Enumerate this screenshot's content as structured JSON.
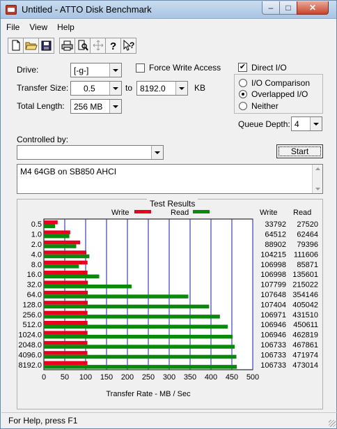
{
  "window": {
    "title": "Untitled - ATTO Disk Benchmark",
    "min": "–",
    "max": "□",
    "close": "✕"
  },
  "menu": [
    "File",
    "View",
    "Help"
  ],
  "toolbar": {
    "icons": [
      "new-file-icon",
      "open-folder-icon",
      "save-disk-icon",
      "print-icon",
      "print-preview-icon",
      "move-icon",
      "help-question-icon",
      "context-help-icon"
    ]
  },
  "settings": {
    "drive_label": "Drive:",
    "drive_value": "[-g-]",
    "force_write_label": "Force Write Access",
    "force_write_checked": false,
    "direct_io_label": "Direct I/O",
    "direct_io_checked": true,
    "transfer_size_label": "Transfer Size:",
    "transfer_from": "0.5",
    "to_label": "to",
    "transfer_to": "8192.0",
    "kb_label": "KB",
    "total_length_label": "Total Length:",
    "total_length_value": "256 MB",
    "io_comparison_label": "I/O Comparison",
    "overlapped_io_label": "Overlapped I/O",
    "neither_label": "Neither",
    "selected_mode": "Overlapped I/O",
    "queue_depth_label": "Queue Depth:",
    "queue_depth_value": "4",
    "controlled_by_label": "Controlled by:",
    "controlled_by_value": "",
    "start_label": "Start",
    "description": "M4 64GB on SB850 AHCI"
  },
  "results": {
    "title": "Test Results",
    "write_legend": "Write",
    "read_legend": "Read",
    "write_col": "Write",
    "read_col": "Read",
    "write_color": "#e8001c",
    "read_color": "#0a8a0a",
    "grid_color": "#1a1aa8"
  },
  "chart_data": {
    "type": "bar",
    "orientation": "horizontal",
    "categories": [
      "0.5",
      "1.0",
      "2.0",
      "4.0",
      "8.0",
      "16.0",
      "32.0",
      "64.0",
      "128.0",
      "256.0",
      "512.0",
      "1024.0",
      "2048.0",
      "4096.0",
      "8192.0"
    ],
    "series": [
      {
        "name": "Write",
        "values": [
          33792,
          64512,
          88902,
          104215,
          106998,
          106998,
          107799,
          107648,
          107404,
          106971,
          106946,
          106946,
          106733,
          106733,
          106733
        ]
      },
      {
        "name": "Read",
        "values": [
          27520,
          62464,
          79396,
          111606,
          85871,
          135601,
          215022,
          354146,
          405042,
          431510,
          450611,
          462819,
          467861,
          471974,
          473014
        ]
      }
    ],
    "xlabel": "Transfer Rate - MB / Sec",
    "xticks": [
      "0",
      "50",
      "100",
      "150",
      "200",
      "250",
      "300",
      "350",
      "400",
      "450",
      "500"
    ],
    "xlim": [
      0,
      500
    ],
    "grid": true,
    "legend": "top"
  },
  "status": {
    "text": "For Help, press F1"
  }
}
